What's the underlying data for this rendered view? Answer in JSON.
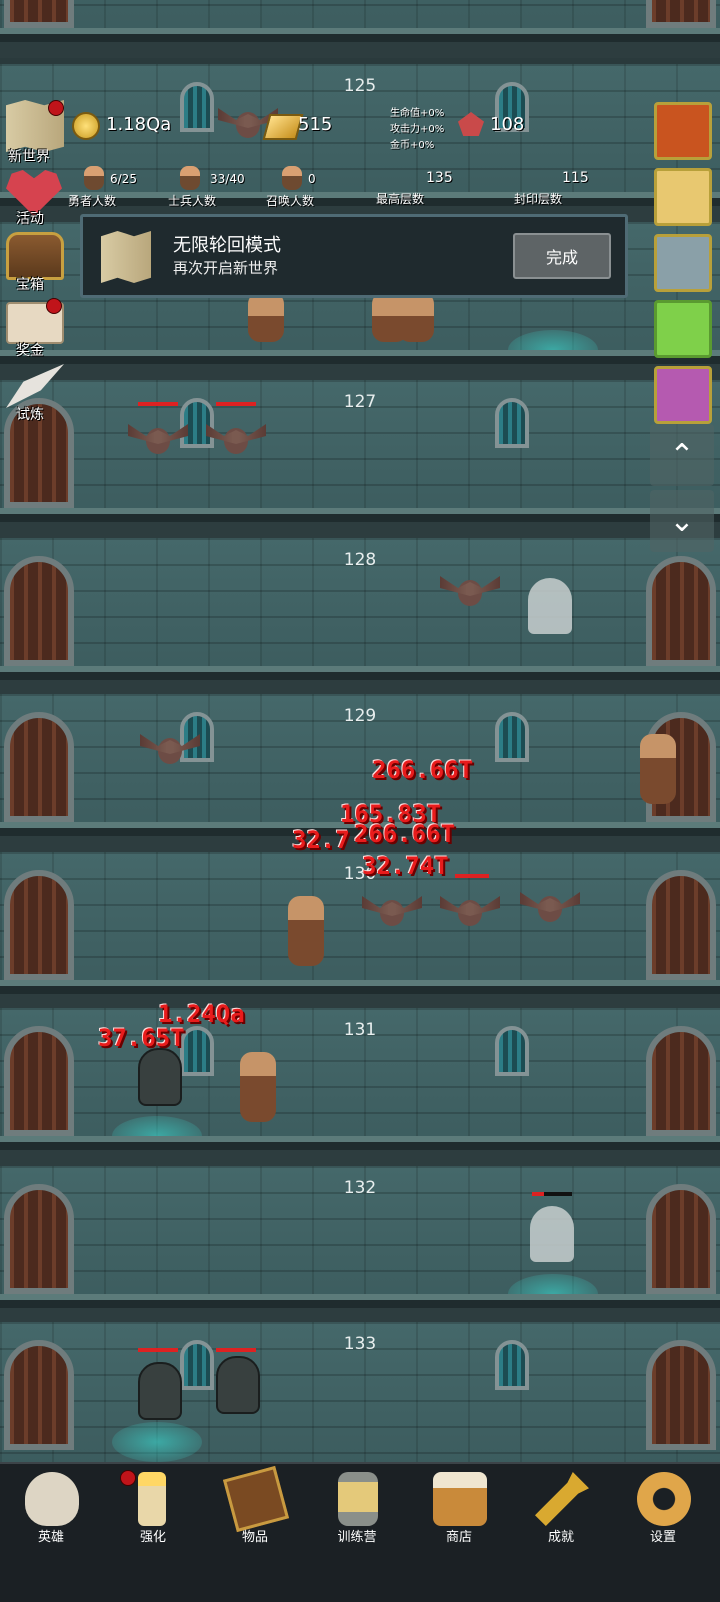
{
  "header": {
    "coins": "1.18Qa",
    "gold_bars": "515",
    "gems": "108",
    "bonus_hp": "生命值+0%",
    "bonus_atk": "攻击力+0%",
    "bonus_gold": "金币+0%",
    "hero_count": "6/25",
    "hero_label": "勇者人数",
    "soldier_count": "33/40",
    "soldier_label": "士兵人数",
    "summon_count": "0",
    "summon_label": "召唤人数",
    "max_floor": "135",
    "max_floor_label": "最高层数",
    "seal_floor": "115",
    "seal_floor_label": "封印层数"
  },
  "left_menu": [
    "新世界",
    "活动",
    "宝箱",
    "奖金",
    "试炼"
  ],
  "right_cards": [
    {
      "name": "apple-card",
      "color": "#c9541f"
    },
    {
      "name": "candle-card",
      "color": "#e8c870"
    },
    {
      "name": "meat-card",
      "color": "#8aa0a8"
    },
    {
      "name": "slime-card",
      "color": "#7fd04a"
    },
    {
      "name": "hero-card",
      "color": "#b55ab0"
    }
  ],
  "toast": {
    "title": "无限轮回模式",
    "subtitle": "再次开启新世界",
    "button": "完成"
  },
  "floors": [
    "125",
    "127",
    "128",
    "129",
    "130",
    "131",
    "132",
    "133"
  ],
  "damage_numbers": [
    "266.66T",
    "165.83T",
    "32.7",
    "266.66T",
    "32.74T",
    "1.24Qa",
    "37.65T"
  ],
  "bottom_nav": [
    "英雄",
    "强化",
    "物品",
    "训练营",
    "商店",
    "成就",
    "设置"
  ]
}
